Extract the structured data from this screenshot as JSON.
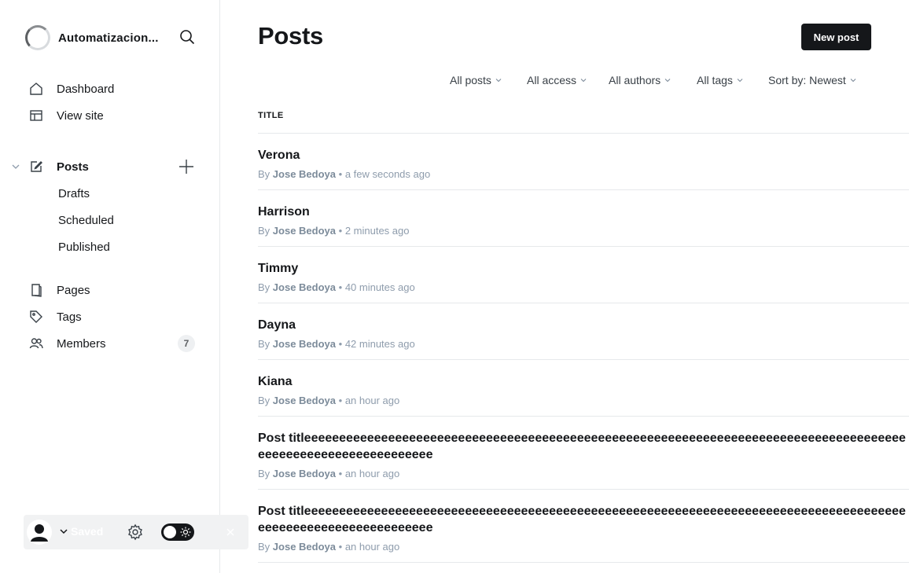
{
  "sidebar": {
    "site_name": "Automatizacion...",
    "nav": {
      "dashboard": "Dashboard",
      "view_site": "View site",
      "posts": "Posts",
      "drafts": "Drafts",
      "scheduled": "Scheduled",
      "published": "Published",
      "pages": "Pages",
      "tags": "Tags",
      "members": "Members",
      "members_count": "7"
    },
    "userbar": {
      "status": "Saved"
    }
  },
  "main": {
    "title": "Posts",
    "new_post_label": "New post",
    "filters": {
      "type": "All posts",
      "access": "All access",
      "authors": "All authors",
      "tags": "All tags",
      "sort": "Sort by: Newest"
    },
    "column_header": "TITLE",
    "posts": [
      {
        "title": "Verona",
        "by": "By",
        "author": "Jose Bedoya",
        "sep": "•",
        "time": "a few seconds ago"
      },
      {
        "title": "Harrison",
        "by": "By",
        "author": "Jose Bedoya",
        "sep": "•",
        "time": "2 minutes ago"
      },
      {
        "title": "Timmy",
        "by": "By",
        "author": "Jose Bedoya",
        "sep": "•",
        "time": "40 minutes ago"
      },
      {
        "title": "Dayna",
        "by": "By",
        "author": "Jose Bedoya",
        "sep": "•",
        "time": "42 minutes ago"
      },
      {
        "title": "Kiana",
        "by": "By",
        "author": "Jose Bedoya",
        "sep": "•",
        "time": "an hour ago"
      },
      {
        "title": "Post titleeeeeeeeeeeeeeeeeeeeeeeeeeeeeeeeeeeeeeeeeeeeeeeeeeeeeeeeeeeeeeeeeeeeeeeeeeeeeeeeeeeeeeeeeeeeeeeeeeeeeeeeeeeeeee",
        "by": "By",
        "author": "Jose Bedoya",
        "sep": "•",
        "time": "an hour ago"
      },
      {
        "title": "Post titleeeeeeeeeeeeeeeeeeeeeeeeeeeeeeeeeeeeeeeeeeeeeeeeeeeeeeeeeeeeeeeeeeeeeeeeeeeeeeeeeeeeeeeeeeeeeeeeeeeeeeeeeeeeeee",
        "by": "By",
        "author": "Jose Bedoya",
        "sep": "•",
        "time": "an hour ago"
      }
    ]
  },
  "icons": {
    "search": "search-icon",
    "home": "home-icon",
    "view_site": "layout-icon",
    "posts": "edit-icon",
    "pages": "page-icon",
    "tags": "tag-icon",
    "members": "members-icon",
    "settings": "gear-icon",
    "theme": "theme-toggle"
  },
  "colors": {
    "accent": "#15171a",
    "muted": "#8e9cac",
    "border": "#e6e9eb"
  }
}
